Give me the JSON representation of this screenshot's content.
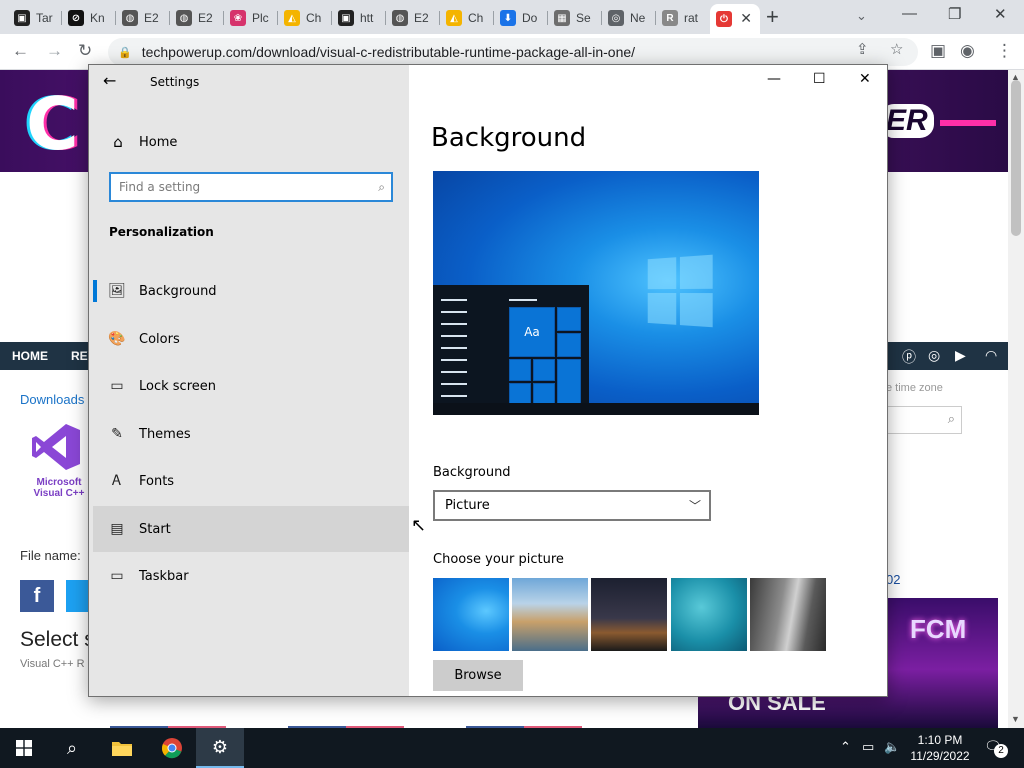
{
  "browser": {
    "tabs": [
      {
        "label": "Tar",
        "color": "#222222",
        "glyph": "▣"
      },
      {
        "label": "Kn",
        "color": "#111111",
        "glyph": "⊘"
      },
      {
        "label": "E2",
        "color": "#555555",
        "glyph": "◍"
      },
      {
        "label": "E2",
        "color": "#555555",
        "glyph": "◍"
      },
      {
        "label": "Plc",
        "color": "#d6336c",
        "glyph": "❀"
      },
      {
        "label": "Ch",
        "color": "#f4b400",
        "glyph": "◭"
      },
      {
        "label": "htt",
        "color": "#222222",
        "glyph": "▣"
      },
      {
        "label": "E2",
        "color": "#555555",
        "glyph": "◍"
      },
      {
        "label": "Ch",
        "color": "#f4b400",
        "glyph": "◭"
      },
      {
        "label": "Do",
        "color": "#1a73e8",
        "glyph": "⬇"
      },
      {
        "label": "Se",
        "color": "#6d6d6d",
        "glyph": "▦"
      },
      {
        "label": "Ne",
        "color": "#5f6368",
        "glyph": "◎"
      },
      {
        "label": "rat",
        "color": "#888888",
        "glyph": "R"
      },
      {
        "label": "",
        "color": "#e53935",
        "glyph": "⏻"
      }
    ],
    "url": "techpowerup.com/download/visual-c-redistributable-runtime-package-all-in-one/"
  },
  "website": {
    "nav_items": [
      "HOME",
      "REV"
    ],
    "breadcrumb": "Downloads",
    "logo_text": [
      "Microsoft",
      "Visual C++"
    ],
    "file_name_label": "File name:",
    "select_heading": "Select s",
    "subtext": "Visual C++ R",
    "timezone_label": "e time zone",
    "number_label": "02",
    "ad_text": "FCM",
    "ad_sale": "ON SALE",
    "banner_right": "ER"
  },
  "settings": {
    "window_title": "Settings",
    "home_label": "Home",
    "search_placeholder": "Find a setting",
    "section": "Personalization",
    "nav": [
      {
        "label": "Background",
        "icon": "picture-icon",
        "glyph": "🖼"
      },
      {
        "label": "Colors",
        "icon": "palette-icon",
        "glyph": "🎨"
      },
      {
        "label": "Lock screen",
        "icon": "lock-screen-icon",
        "glyph": "▭"
      },
      {
        "label": "Themes",
        "icon": "themes-icon",
        "glyph": "✎"
      },
      {
        "label": "Fonts",
        "icon": "fonts-icon",
        "glyph": "Ꭺ"
      },
      {
        "label": "Start",
        "icon": "start-icon",
        "glyph": "▤"
      },
      {
        "label": "Taskbar",
        "icon": "taskbar-icon",
        "glyph": "▭"
      }
    ],
    "selected": "Background",
    "page_title": "Background",
    "preview_tile_text": "Aa",
    "background_label": "Background",
    "background_value": "Picture",
    "choose_label": "Choose your picture",
    "browse_label": "Browse"
  },
  "taskbar": {
    "time": "1:10 PM",
    "date": "11/29/2022",
    "notifications": "2"
  }
}
